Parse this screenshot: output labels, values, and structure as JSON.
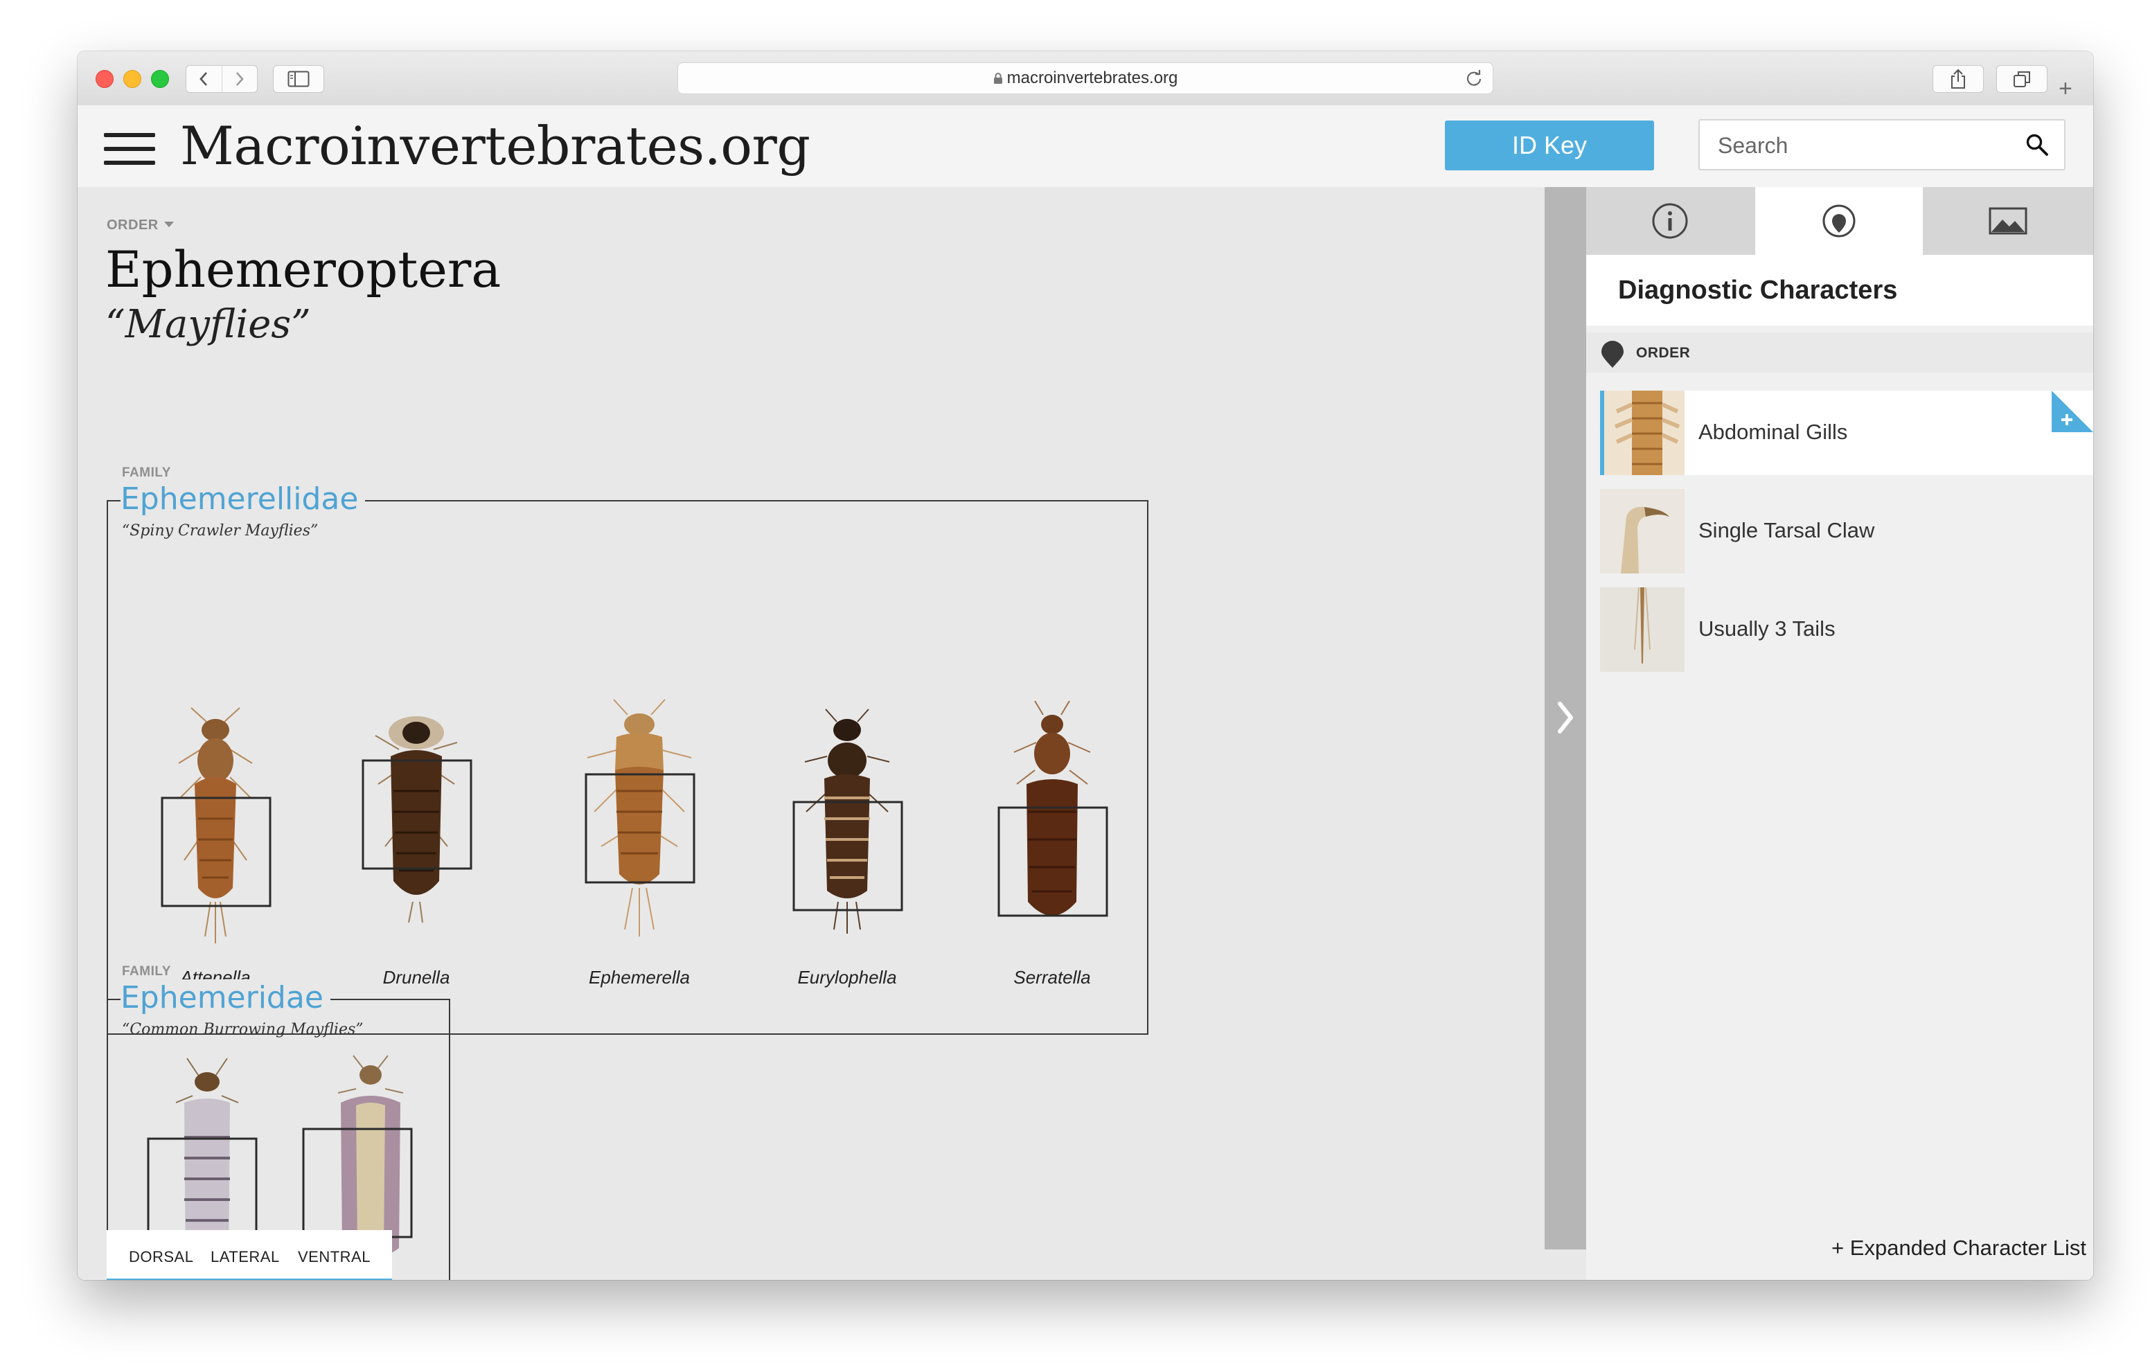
{
  "browser": {
    "url": "macroinvertebrates.org",
    "new_tab": "+"
  },
  "header": {
    "site_title": "Macroinvertebrates.org",
    "id_key_label": "ID Key",
    "search_placeholder": "Search"
  },
  "order": {
    "rank_label": "ORDER",
    "name": "Ephemeroptera",
    "common_name": "“Mayflies”"
  },
  "families": [
    {
      "rank_label": "FAMILY",
      "name": "Ephemerellidae",
      "common_name": "“Spiny Crawler Mayflies”",
      "genera": [
        "Attenella",
        "Drunella",
        "Ephemerella",
        "Eurylophella",
        "Serratella"
      ]
    },
    {
      "rank_label": "FAMILY",
      "name": "Ephemeridae",
      "common_name": "“Common Burrowing Mayflies”",
      "genera": []
    }
  ],
  "view_tabs": [
    "DORSAL",
    "LATERAL",
    "VENTRAL"
  ],
  "panel": {
    "title": "Diagnostic Characters",
    "order_label": "ORDER",
    "characters": [
      "Abdominal Gills",
      "Single Tarsal Claw",
      "Usually 3 Tails"
    ],
    "expand_link": "+ Expanded Character List",
    "tabs": [
      "info-icon",
      "diagnostic-pin-icon",
      "image-icon"
    ],
    "active_tab": "diagnostic-pin-icon"
  },
  "colors": {
    "accent": "#50aedf",
    "family_name": "#4fa3d4",
    "drawer": "#b6b6b6"
  }
}
